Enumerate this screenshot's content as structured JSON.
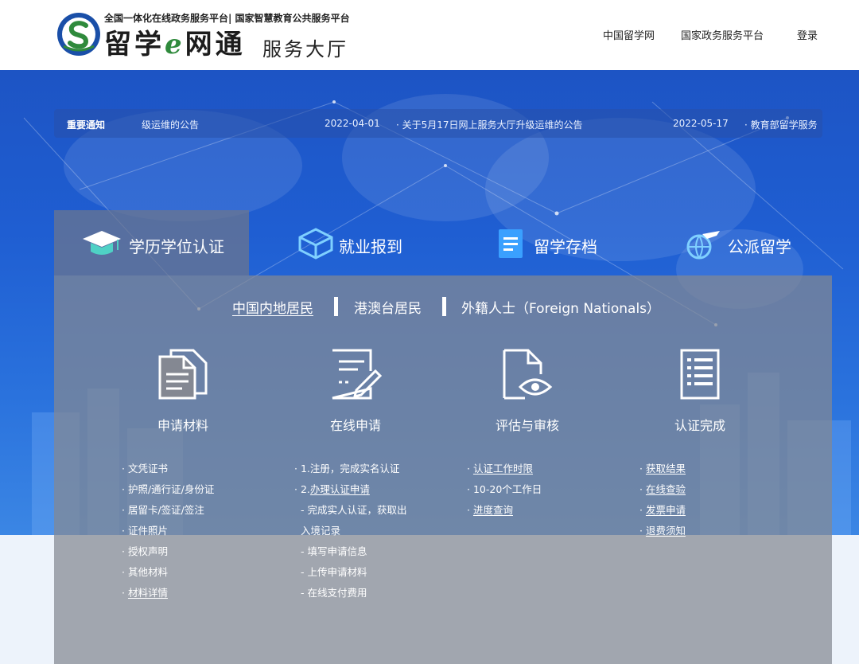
{
  "header": {
    "slogan": "全国一体化在线政务服务平台| 国家智慧教育公共服务平台",
    "brand_1": "留学",
    "brand_e": "e",
    "brand_2": "网通",
    "brand_sub": "服务大厅",
    "nav": [
      "中国留学网",
      "国家政务服务平台",
      "登录"
    ]
  },
  "notice": {
    "label": "重要通知",
    "items": [
      {
        "text": "级运维的公告"
      },
      {
        "date": "2022-04-01",
        "text": "· 关于5月17日网上服务大厅升级运维的公告"
      },
      {
        "date": "2022-05-17",
        "text": "· 教育部留学服务"
      }
    ]
  },
  "tabs": [
    {
      "label": "学历学位认证",
      "icon": "graduation-cap-icon",
      "active": true
    },
    {
      "label": "就业报到",
      "icon": "cube-shield-icon",
      "active": false
    },
    {
      "label": "留学存档",
      "icon": "archive-icon",
      "active": false
    },
    {
      "label": "公派留学",
      "icon": "airplane-globe-icon",
      "active": false
    }
  ],
  "subtabs": [
    "中国内地居民",
    "港澳台居民",
    "外籍人士（Foreign Nationals）"
  ],
  "steps": [
    {
      "title": "申请材料",
      "icon": "documents-icon",
      "items": [
        {
          "text": "· 文凭证书",
          "link": false
        },
        {
          "text": "· 护照/通行证/身份证",
          "link": false
        },
        {
          "text": "· 居留卡/签证/签注",
          "link": false
        },
        {
          "text": "· 证件照片",
          "link": false
        },
        {
          "text": "· 授权声明",
          "link": false
        },
        {
          "text": "· 其他材料",
          "link": false
        },
        {
          "pre": "· ",
          "text": "材料详情",
          "link": true
        }
      ]
    },
    {
      "title": "在线申请",
      "icon": "edit-form-icon",
      "items": [
        {
          "text": "· 1.注册，完成实名认证",
          "link": false
        },
        {
          "pre": "· 2.",
          "text": "办理认证申请",
          "link": true
        },
        {
          "text": "- 完成实人认证，获取出",
          "link": false,
          "indent": true
        },
        {
          "text": "入境记录",
          "link": false,
          "indent": true
        },
        {
          "text": "- 填写申请信息",
          "link": false,
          "indent": true
        },
        {
          "text": "- 上传申请材料",
          "link": false,
          "indent": true
        },
        {
          "text": "- 在线支付费用",
          "link": false,
          "indent": true
        }
      ]
    },
    {
      "title": "评估与审核",
      "icon": "document-eye-icon",
      "items": [
        {
          "pre": "· ",
          "text": "认证工作时限",
          "link": true
        },
        {
          "text": "· 10-20个工作日",
          "link": false
        },
        {
          "pre": "· ",
          "text": "进度查询",
          "link": true
        }
      ]
    },
    {
      "title": "认证完成",
      "icon": "checklist-icon",
      "items": [
        {
          "pre": "· ",
          "text": "获取结果",
          "link": true
        },
        {
          "pre": "· ",
          "text": "在线查验",
          "link": true
        },
        {
          "pre": "· ",
          "text": "发票申请",
          "link": true
        },
        {
          "pre": "· ",
          "text": "退费须知",
          "link": true
        }
      ]
    }
  ]
}
